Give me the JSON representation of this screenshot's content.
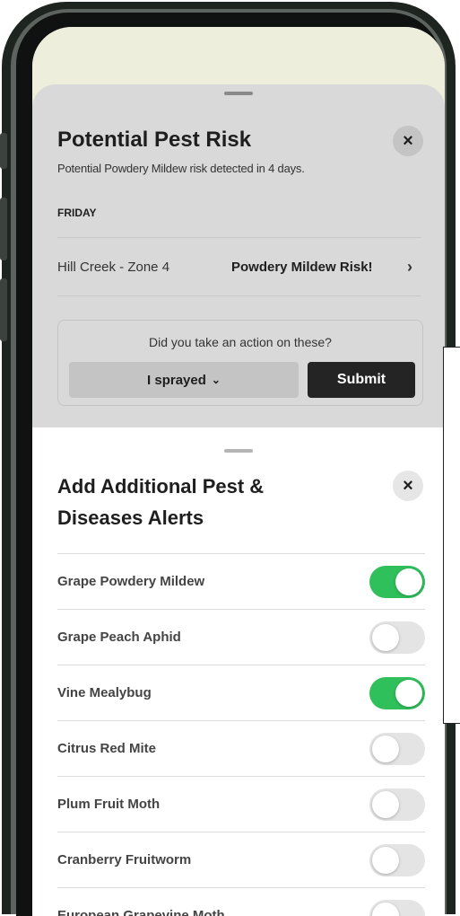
{
  "pest_risk": {
    "title": "Potential Pest Risk",
    "subtitle": "Potential Powdery Mildew risk detected in 4 days.",
    "close_glyph": "×",
    "day": "FRIDAY",
    "location": "Hill Creek - Zone 4",
    "risk": "Powdery Mildew Risk!",
    "chevron": "›",
    "question": "Did you take an action on these?",
    "action_select": "I sprayed",
    "select_chevron": "⌄",
    "submit_label": "Submit"
  },
  "additional_alerts": {
    "title": "Add Additional Pest & Diseases Alerts",
    "close_glyph": "×",
    "items": [
      {
        "label": "Grape Powdery Mildew",
        "enabled": true
      },
      {
        "label": "Grape Peach Aphid",
        "enabled": false
      },
      {
        "label": "Vine Mealybug",
        "enabled": true
      },
      {
        "label": "Citrus Red Mite",
        "enabled": false
      },
      {
        "label": "Plum Fruit Moth",
        "enabled": false
      },
      {
        "label": "Cranberry Fruitworm",
        "enabled": false
      },
      {
        "label": "European Grapevine Moth",
        "enabled": false
      }
    ]
  },
  "colors": {
    "toggle_on": "#2fbf5b",
    "toggle_off": "#e4e4e4",
    "submit_bg": "#242424",
    "sheet_bg": "#d9d9d9"
  }
}
